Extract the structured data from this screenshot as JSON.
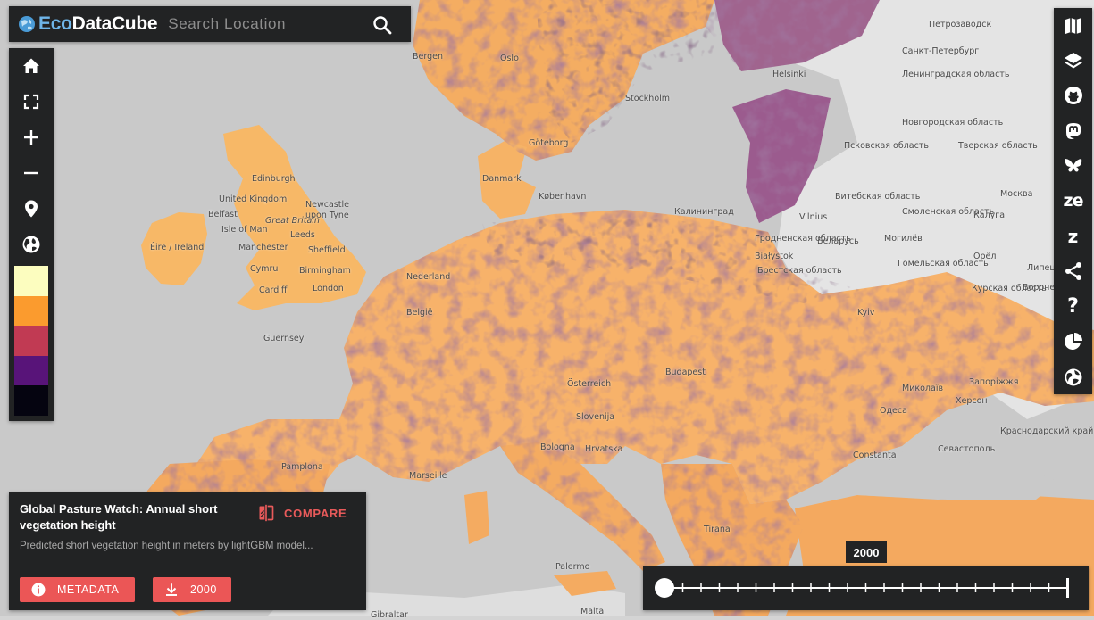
{
  "app": {
    "logo_eco": "Eco",
    "logo_datacube": "DataCube",
    "search_placeholder": "Search Location"
  },
  "left_toolbar": {
    "buttons": [
      "home-icon",
      "fullscreen-icon",
      "zoom-in-icon",
      "zoom-out-icon",
      "location-pin-icon",
      "globe-icon"
    ],
    "legend_colors": [
      "#fcfdbf",
      "#fb9b2e",
      "#c13a53",
      "#581479",
      "#050410"
    ]
  },
  "right_toolbar": {
    "buttons": [
      "map-icon",
      "layers-icon",
      "github-icon",
      "mastodon-icon",
      "bluesky-icon",
      "zenodo-icon",
      "zotero-icon",
      "share-icon",
      "help-icon",
      "pie-chart-icon",
      "world-icon"
    ],
    "zenodo_text": "ze",
    "zotero_text": "z",
    "help_text": "?"
  },
  "layer_panel": {
    "title": "Global Pasture Watch: Annual short vegetation height",
    "compare_label": "COMPARE",
    "description": "Predicted short vegetation height in meters by lightGBM model...",
    "metadata_label": "METADATA",
    "download_label": "2000"
  },
  "timeline": {
    "selected_year": "2000",
    "tick_count": 22
  },
  "map": {
    "labels": [
      "Bergen",
      "Oslo",
      "Stockholm",
      "Helsinki",
      "Петрозаводск",
      "Göteborg",
      "København",
      "Danmark",
      "Edinburgh",
      "United Kingdom",
      "Newcastle upon Tyne",
      "Belfast",
      "Isle of Man",
      "Great Britain",
      "Leeds",
      "Manchester",
      "Sheffield",
      "Éire / Ireland",
      "Cymru",
      "Birmingham",
      "Cardiff",
      "London",
      "Guernsey",
      "Nederland",
      "België",
      "Калининград",
      "Vilnius",
      "Беларусь",
      "Białystok",
      "Брестская область",
      "Санкт-Петербург",
      "Ленинградская область",
      "Новгородская область",
      "Псковская область",
      "Тверская область",
      "Москва",
      "Калуга",
      "Смоленская область",
      "Орёл",
      "Липецк",
      "Курская область",
      "Воронеж",
      "Могилёв",
      "Гомельская область",
      "Витебская область",
      "Гродненская область",
      "Kyiv",
      "Запоріжжя",
      "Миколаїв",
      "Одеса",
      "Херсон",
      "Севастополь",
      "Краснодарский край",
      "Constanța",
      "Bologna",
      "Marseille",
      "Pamplona",
      "Palermo",
      "Malta",
      "Gibraltar",
      "Hrvatska",
      "Slovenija",
      "Österreich",
      "Budapest",
      "Tirana"
    ],
    "colors": {
      "sea": "#c5c5c5",
      "land_outside": "#e6e6e6",
      "veg_light": "#f9c46f",
      "veg_orange": "#f2a255",
      "veg_purple": "#8c4c8c",
      "veg_dark": "#3a2438"
    }
  }
}
